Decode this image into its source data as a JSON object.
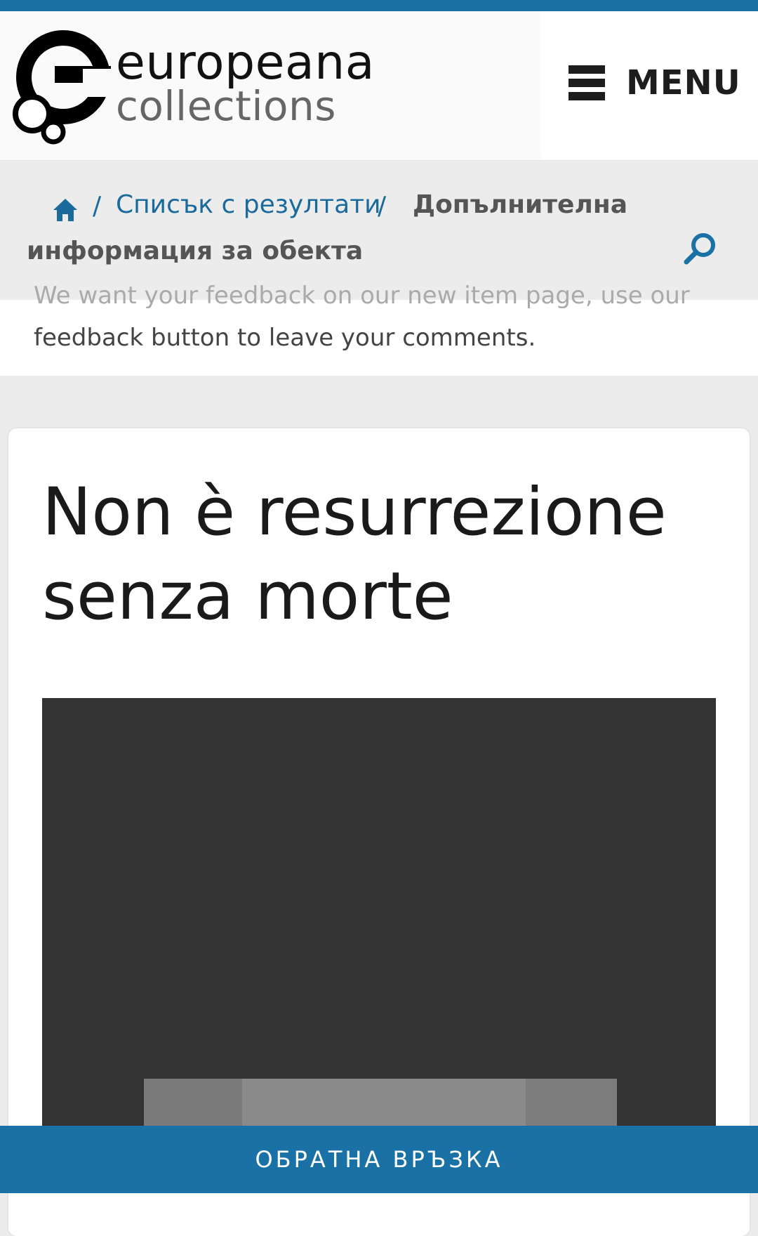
{
  "header": {
    "logo_primary": "europeana",
    "logo_secondary": "collections",
    "menu_label": "MENU"
  },
  "breadcrumb": {
    "separator": "/",
    "results_link": "Списък с резултати",
    "current_line1": "Допълнителна",
    "current_line2": "информация за обекта"
  },
  "notice": {
    "line1": "We want your feedback on our new item page, use our",
    "line2": "feedback button to leave your comments."
  },
  "item": {
    "title": "Non è resurrezione senza morte"
  },
  "footer": {
    "feedback_label": "ОБРАТНА ВРЪЗКА"
  },
  "colors": {
    "accent": "#1a71a6",
    "link": "#1a6a9c",
    "viewer_bg": "#333333",
    "page_bg": "#ececec"
  },
  "icons": [
    "europeana-logo-icon",
    "menu-icon",
    "home-icon",
    "search-icon"
  ]
}
